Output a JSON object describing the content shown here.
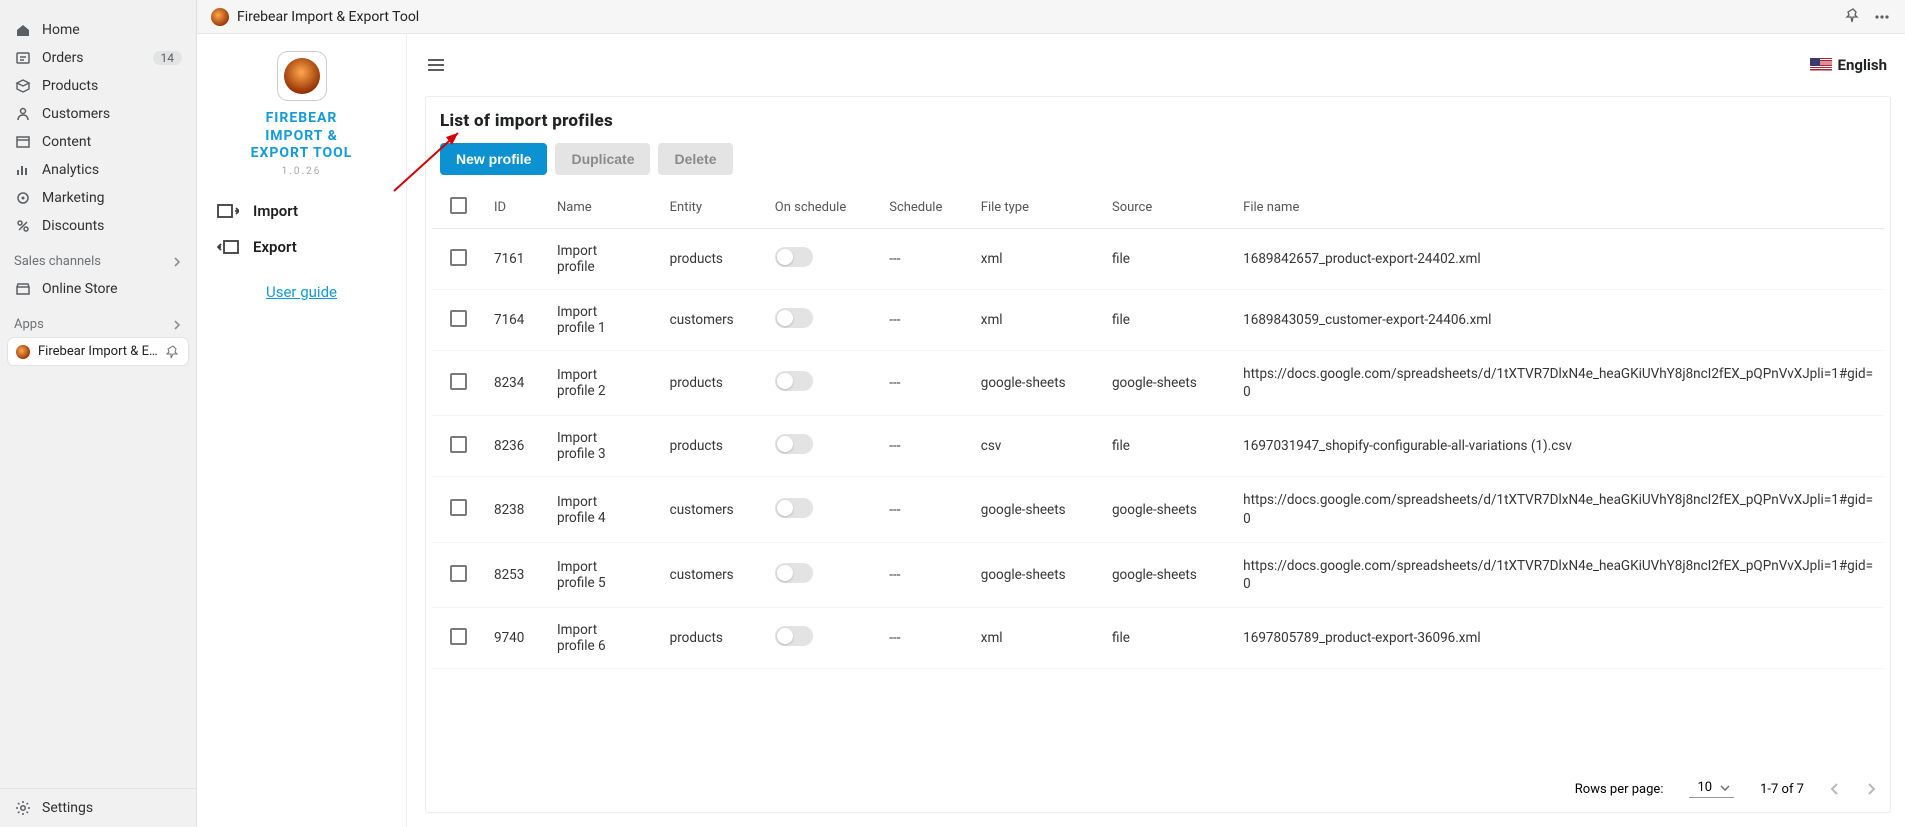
{
  "shopify_nav": {
    "items": [
      {
        "label": "Home",
        "icon": "home-icon",
        "badge": ""
      },
      {
        "label": "Orders",
        "icon": "orders-icon",
        "badge": "14"
      },
      {
        "label": "Products",
        "icon": "products-icon",
        "badge": ""
      },
      {
        "label": "Customers",
        "icon": "customers-icon",
        "badge": ""
      },
      {
        "label": "Content",
        "icon": "content-icon",
        "badge": ""
      },
      {
        "label": "Analytics",
        "icon": "analytics-icon",
        "badge": ""
      },
      {
        "label": "Marketing",
        "icon": "marketing-icon",
        "badge": ""
      },
      {
        "label": "Discounts",
        "icon": "discounts-icon",
        "badge": ""
      }
    ],
    "sales_channels_label": "Sales channels",
    "online_store_label": "Online Store",
    "apps_label": "Apps",
    "app_row_label": "Firebear Import & Exp...",
    "settings_label": "Settings"
  },
  "topbar": {
    "title": "Firebear Import & Export Tool"
  },
  "fb_nav": {
    "title_line1": "FIREBEAR",
    "title_line2": "IMPORT &",
    "title_line3": "EXPORT TOOL",
    "version": "1.0.26",
    "import_label": "Import",
    "export_label": "Export",
    "user_guide_label": "User guide"
  },
  "main": {
    "language": "English",
    "heading": "List of import profiles",
    "buttons": {
      "new": "New profile",
      "dup": "Duplicate",
      "del": "Delete"
    },
    "columns": {
      "id": "ID",
      "name": "Name",
      "entity": "Entity",
      "onsched": "On schedule",
      "sched": "Schedule",
      "ftype": "File type",
      "source": "Source",
      "fname": "File name"
    },
    "rows": [
      {
        "id": "7161",
        "name": "Import profile",
        "entity": "products",
        "schedule": "---",
        "file_type": "xml",
        "source": "file",
        "file_name": "1689842657_product-export-24402.xml"
      },
      {
        "id": "7164",
        "name": "Import profile 1",
        "entity": "customers",
        "schedule": "---",
        "file_type": "xml",
        "source": "file",
        "file_name": "1689843059_customer-export-24406.xml"
      },
      {
        "id": "8234",
        "name": "Import profile 2",
        "entity": "products",
        "schedule": "---",
        "file_type": "google-sheets",
        "source": "google-sheets",
        "file_name": "https://docs.google.com/spreadsheets/d/1tXTVR7DlxN4e_heaGKiUVhY8j8ncI2fEX_pQPnVvXJpli=1#gid=0"
      },
      {
        "id": "8236",
        "name": "Import profile 3",
        "entity": "products",
        "schedule": "---",
        "file_type": "csv",
        "source": "file",
        "file_name": "1697031947_shopify-configurable-all-variations (1).csv"
      },
      {
        "id": "8238",
        "name": "Import profile 4",
        "entity": "customers",
        "schedule": "---",
        "file_type": "google-sheets",
        "source": "google-sheets",
        "file_name": "https://docs.google.com/spreadsheets/d/1tXTVR7DlxN4e_heaGKiUVhY8j8ncI2fEX_pQPnVvXJpli=1#gid=0"
      },
      {
        "id": "8253",
        "name": "Import profile 5",
        "entity": "customers",
        "schedule": "---",
        "file_type": "google-sheets",
        "source": "google-sheets",
        "file_name": "https://docs.google.com/spreadsheets/d/1tXTVR7DlxN4e_heaGKiUVhY8j8ncI2fEX_pQPnVvXJpli=1#gid=0"
      },
      {
        "id": "9740",
        "name": "Import profile 6",
        "entity": "products",
        "schedule": "---",
        "file_type": "xml",
        "source": "file",
        "file_name": "1697805789_product-export-36096.xml"
      }
    ],
    "pagination": {
      "rows_per_page_label": "Rows per page:",
      "per_page": "10",
      "range": "1-7 of 7"
    }
  }
}
